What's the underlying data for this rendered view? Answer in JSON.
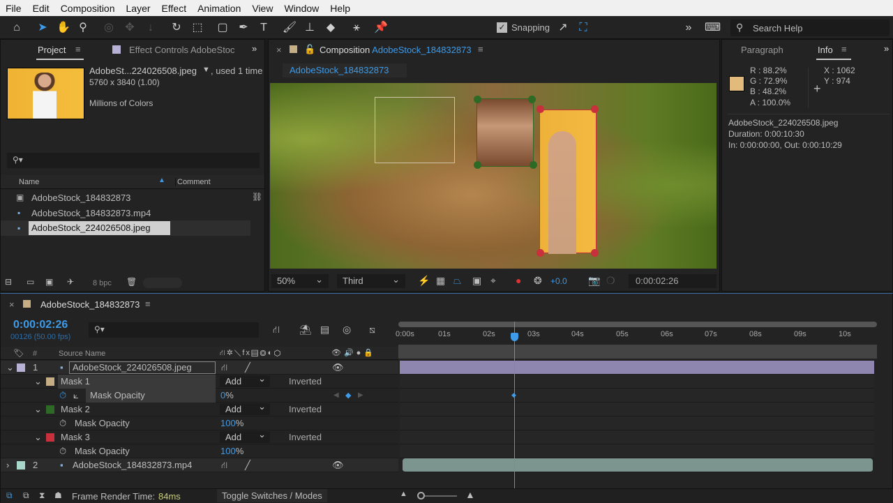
{
  "menu": [
    "File",
    "Edit",
    "Composition",
    "Layer",
    "Effect",
    "Animation",
    "View",
    "Window",
    "Help"
  ],
  "toolbar": {
    "snapping": "Snapping",
    "search_placeholder": "Search Help"
  },
  "project": {
    "tab": "Project",
    "effect_tab": "Effect Controls",
    "effect_tab_target": "AdobeStoc",
    "selected_name": "AdobeSt...224026508.jpeg",
    "used": ", used 1 time",
    "dimensions": "5760 x 3840 (1.00)",
    "colors": "Millions of Colors",
    "col_name": "Name",
    "col_comment": "Comment",
    "items": [
      "AdobeStock_184832873",
      "AdobeStock_184832873.mp4",
      "AdobeStock_224026508.jpeg"
    ],
    "bpc": "8 bpc"
  },
  "comp": {
    "tab_label": "Composition",
    "tab_name": "AdobeStock_184832873",
    "breadcrumb": "AdobeStock_184832873",
    "zoom": "50%",
    "resolution": "Third",
    "exposure": "+0.0",
    "timecode": "0:00:02:26"
  },
  "info": {
    "paragraph_tab": "Paragraph",
    "info_tab": "Info",
    "r": "R :  88.2%",
    "g": "G :  72.9%",
    "b": "B :  48.2%",
    "a": "A :  100.0%",
    "x": "X : 1062",
    "y": "Y : 974",
    "swatch": "#e2ba7b",
    "file": "AdobeStock_224026508.jpeg",
    "duration": "Duration: 0:00:10:30",
    "inout": "In: 0:00:00:00, Out: 0:00:10:29"
  },
  "timeline": {
    "comp_name": "AdobeStock_184832873",
    "timecode": "0:00:02:26",
    "frames": "00126 (50.00 fps)",
    "col_num": "#",
    "col_source": "Source Name",
    "ticks": [
      "0:00s",
      "01s",
      "02s",
      "03s",
      "04s",
      "05s",
      "06s",
      "07s",
      "08s",
      "09s",
      "10s"
    ],
    "layers": [
      {
        "num": "1",
        "name": "AdobeStock_224026508.jpeg",
        "color": "#b7b1d6"
      },
      {
        "num": "2",
        "name": "AdobeStock_184832873.mp4",
        "color": "#a9d6cb"
      }
    ],
    "masks": [
      {
        "name": "Mask 1",
        "mode": "Add",
        "inverted": "Inverted",
        "prop": "Mask Opacity",
        "value": "0",
        "unit": "%",
        "color": "#c5ad84"
      },
      {
        "name": "Mask 2",
        "mode": "Add",
        "inverted": "Inverted",
        "prop": "Mask Opacity",
        "value": "100",
        "unit": "%",
        "color": "#2d6a26"
      },
      {
        "name": "Mask 3",
        "mode": "Add",
        "inverted": "Inverted",
        "prop": "Mask Opacity",
        "value": "100",
        "unit": "%",
        "color": "#c8303b"
      }
    ],
    "render_label": "Frame Render Time:",
    "render_value": "84ms",
    "toggle": "Toggle Switches / Modes"
  }
}
